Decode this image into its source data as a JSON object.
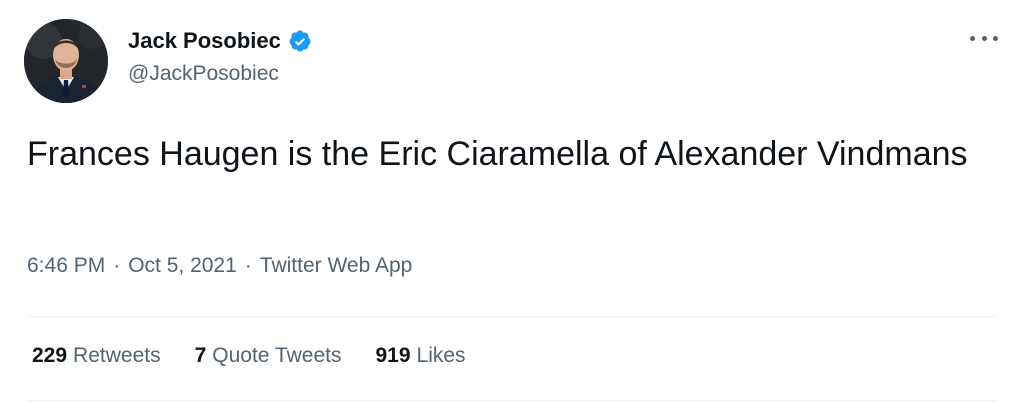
{
  "author": {
    "display_name": "Jack Posobiec",
    "handle": "@JackPosobiec",
    "verified": true,
    "verified_color": "#1d9bf0"
  },
  "tweet": {
    "text": "Frances Haugen is the Eric Ciaramella of Alexander Vindmans"
  },
  "meta": {
    "time": "6:46 PM",
    "separator": "·",
    "date": "Oct 5, 2021",
    "source": "Twitter Web App"
  },
  "stats": {
    "retweets_count": "229",
    "retweets_label": "Retweets",
    "quotes_count": "7",
    "quotes_label": "Quote Tweets",
    "likes_count": "919",
    "likes_label": "Likes"
  },
  "icons": {
    "more": "more-horizontal-icon",
    "verified": "verified-badge-icon"
  },
  "colors": {
    "text_primary": "#0f1419",
    "text_secondary": "#536471",
    "divider": "#eff3f4"
  }
}
